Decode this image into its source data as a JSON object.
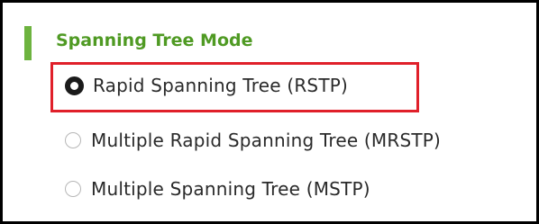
{
  "section": {
    "title": "Spanning Tree Mode",
    "accent_color": "#6db33f"
  },
  "options": [
    {
      "label": "Rapid Spanning Tree (RSTP)",
      "selected": true
    },
    {
      "label": "Multiple Rapid Spanning Tree (MRSTP)",
      "selected": false
    },
    {
      "label": "Multiple Spanning Tree (MSTP)",
      "selected": false
    }
  ],
  "highlight": {
    "color": "#e0202a",
    "target": "Rapid Spanning Tree (RSTP)"
  }
}
